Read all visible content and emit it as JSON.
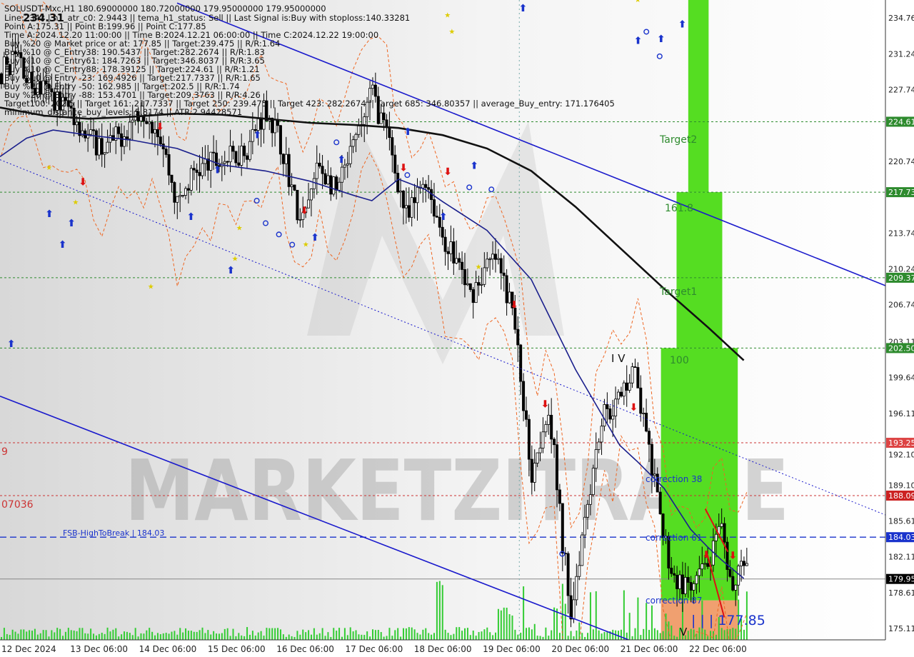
{
  "header": {
    "symbol_line": "SOLUSDT-Mxc,H1  180.69000000 180.72000000 179.95000000 179.95000000",
    "price_tag": "234.31",
    "lines": [
      "Line:2342 | h1_atr_c0: 2.9443 || tema_h1_status: Sell || Last Signal is:Buy with stoploss:140.33281",
      "Point A:175.31 || Point B:199.96 || Point C:177.85",
      "Time A:2024.12.20 11:00:00 || Time B:2024.12.21 06:00:00 || Time C:2024.12.22 19:00:00",
      "Buy %20 @ Market price or at: 177.85 || Target:239.475 || R/R:1.64",
      "Buy %10 @ C_Entry38: 190.5437 || Target:282.2674 || R/R:1.83",
      "Buy %10 @ C_Entry61: 184.7263 || Target:346.8037 || R/R:3.65",
      "Buy %10 @ C_Entry88: 178.39125 || Target:224.61 || R/R:1.21",
      "Buy %10 @ Entry -23: 169.4926 || Target:217.7337 || R/R:1.65",
      "Buy %20 @ Entry -50: 162.985 || Target:202.5 || R/R:1.74",
      "Buy %20 @ Entry -88: 153.4701 || Target:209.3763 || R/R:4.26",
      "Target100: 202.5 || Target 161: 217.7337 || Target 250: 239.475 || Target 423: 282.2674 || Target 685: 346.80357 || average_Buy_entry: 171.176405",
      "minimum_distance_buy_levels: 5.8174 || ATR:2.94428571"
    ]
  },
  "levels": {
    "target2": "Target2",
    "l1618": "161.8",
    "target1": "Target1",
    "l100": "100",
    "corr38": "correction 38",
    "corr61": "correction 61",
    "corr87": "correction 87",
    "fsb": "FSB-HighToBreak | 184.03",
    "pointc": "| | | 177.85",
    "left_9": "9",
    "left_07036": "07036",
    "label_iv": "I V",
    "label_v": "V"
  },
  "watermark": "MARKETZITRADE",
  "colors": {
    "bull": "#000000",
    "bear": "#000000",
    "green_zone": "#55dd22",
    "orange_zone": "#f0a070",
    "ma_blue": "#1a1f8c",
    "ma_black": "#111111",
    "channel": "#1a1acc",
    "buy_arrow": "#1a33cc",
    "sell_arrow": "#dd1111"
  },
  "chart_data": {
    "type": "candlestick",
    "y_ticks": [
      "234.76",
      "231.24",
      "227.74",
      "224.61",
      "220.74",
      "217.73",
      "213.74",
      "210.24",
      "209.37",
      "206.74",
      "203.11",
      "202.50",
      "199.64",
      "196.11",
      "193.25",
      "192.10",
      "189.10",
      "188.09",
      "185.61",
      "184.03",
      "182.11",
      "179.95",
      "178.61",
      "175.11"
    ],
    "y_axis_labels": [
      {
        "value": 234.76,
        "text": "234.76"
      },
      {
        "value": 231.24,
        "text": "231.24"
      },
      {
        "value": 227.74,
        "text": "227.74"
      },
      {
        "value": 224.61,
        "text": "224.61",
        "box": "#2e8b2e"
      },
      {
        "value": 220.74,
        "text": "220.74"
      },
      {
        "value": 217.73,
        "text": "217.73",
        "box": "#2e8b2e"
      },
      {
        "value": 213.74,
        "text": "213.74"
      },
      {
        "value": 210.24,
        "text": "210.24"
      },
      {
        "value": 209.37,
        "text": "209.37",
        "box": "#2e8b2e"
      },
      {
        "value": 206.74,
        "text": "206.74"
      },
      {
        "value": 203.11,
        "text": "203.11"
      },
      {
        "value": 202.5,
        "text": "202.50",
        "box": "#2e8b2e"
      },
      {
        "value": 199.64,
        "text": "199.64"
      },
      {
        "value": 196.11,
        "text": "196.11"
      },
      {
        "value": 193.25,
        "text": "193.25",
        "box": "#dd4444"
      },
      {
        "value": 192.1,
        "text": "192.10"
      },
      {
        "value": 189.1,
        "text": "189.10"
      },
      {
        "value": 188.09,
        "text": "188.09",
        "box": "#cc2222"
      },
      {
        "value": 185.61,
        "text": "185.61"
      },
      {
        "value": 184.03,
        "text": "184.03",
        "box": "#1a33cc"
      },
      {
        "value": 182.11,
        "text": "182.11"
      },
      {
        "value": 179.95,
        "text": "179.95",
        "box": "#000000"
      },
      {
        "value": 178.61,
        "text": "178.61"
      },
      {
        "value": 175.11,
        "text": "175.11"
      }
    ],
    "x_ticks": [
      "12 Dec 2024",
      "13 Dec 06:00",
      "14 Dec 06:00",
      "15 Dec 06:00",
      "16 Dec 06:00",
      "17 Dec 06:00",
      "18 Dec 06:00",
      "19 Dec 06:00",
      "20 Dec 06:00",
      "21 Dec 06:00",
      "22 Dec 06:00"
    ],
    "ylim": [
      174.0,
      236.5
    ],
    "horizontal_levels": [
      {
        "value": 224.61,
        "style": "dotted",
        "color": "#2e8b2e"
      },
      {
        "value": 217.73,
        "style": "dotted",
        "color": "#2e8b2e"
      },
      {
        "value": 209.37,
        "style": "dotted",
        "color": "#2e8b2e"
      },
      {
        "value": 202.5,
        "style": "dotted",
        "color": "#2e8b2e"
      },
      {
        "value": 193.25,
        "style": "dotted",
        "color": "#cc3333"
      },
      {
        "value": 188.09,
        "style": "dotted",
        "color": "#cc3333"
      },
      {
        "value": 184.03,
        "style": "dashed",
        "color": "#1a33cc"
      },
      {
        "value": 179.95,
        "style": "solid",
        "color": "#888888"
      }
    ],
    "zones": [
      {
        "name": "target2-zone",
        "x0": 0.7773,
        "x1": 0.8003,
        "y0": 236.5,
        "y1": 217.73,
        "color": "#55dd22"
      },
      {
        "name": "161-zone",
        "x0": 0.7641,
        "x1": 0.8157,
        "y0": 217.73,
        "y1": 202.5,
        "color": "#55dd22"
      },
      {
        "name": "100-zone",
        "x0": 0.7465,
        "x1": 0.8332,
        "y0": 202.5,
        "y1": 177.85,
        "color": "#55dd22"
      },
      {
        "name": "corr87-zone",
        "x0": 0.7465,
        "x1": 0.8332,
        "y0": 177.85,
        "y1": 174.0,
        "color": "#f0a070"
      }
    ],
    "channel_lines": [
      {
        "name": "upper-channel",
        "t0": 0.2,
        "v0": 236.2,
        "t1": 1.0,
        "v1": 208.6,
        "style": "solid",
        "width": 1.6
      },
      {
        "name": "lower-channel",
        "t0": 0.0,
        "v0": 197.8,
        "t1": 0.71,
        "v1": 174.0,
        "style": "solid",
        "width": 1.6
      },
      {
        "name": "mid-channel",
        "t0": 0.0,
        "v0": 220.9,
        "t1": 1.0,
        "v1": 186.2,
        "style": "dotted",
        "width": 1.0
      }
    ],
    "ma_black": [
      [
        0.0,
        226.0
      ],
      [
        0.05,
        225.2
      ],
      [
        0.1,
        224.9
      ],
      [
        0.15,
        225.1
      ],
      [
        0.2,
        225.4
      ],
      [
        0.25,
        225.3
      ],
      [
        0.3,
        224.9
      ],
      [
        0.35,
        224.5
      ],
      [
        0.4,
        224.3
      ],
      [
        0.45,
        224.0
      ],
      [
        0.5,
        223.3
      ],
      [
        0.55,
        222.0
      ],
      [
        0.6,
        219.8
      ],
      [
        0.65,
        216.3
      ],
      [
        0.7,
        212.3
      ],
      [
        0.75,
        208.3
      ],
      [
        0.8,
        204.5
      ],
      [
        0.84,
        201.3
      ]
    ],
    "ma_blue": [
      [
        0.0,
        221.2
      ],
      [
        0.03,
        223.0
      ],
      [
        0.06,
        223.8
      ],
      [
        0.1,
        223.3
      ],
      [
        0.15,
        222.8
      ],
      [
        0.2,
        222.0
      ],
      [
        0.25,
        220.4
      ],
      [
        0.3,
        219.8
      ],
      [
        0.35,
        218.8
      ],
      [
        0.4,
        217.4
      ],
      [
        0.42,
        216.9
      ],
      [
        0.45,
        219.0
      ],
      [
        0.48,
        218.0
      ],
      [
        0.5,
        216.8
      ],
      [
        0.55,
        214.0
      ],
      [
        0.6,
        209.2
      ],
      [
        0.65,
        200.4
      ],
      [
        0.7,
        193.0
      ],
      [
        0.72,
        191.4
      ],
      [
        0.75,
        188.8
      ],
      [
        0.78,
        184.8
      ],
      [
        0.8,
        183.0
      ],
      [
        0.815,
        181.8
      ],
      [
        0.84,
        180.0
      ]
    ],
    "ohlc_path": [
      [
        0.0,
        229.3
      ],
      [
        0.02,
        231.2
      ],
      [
        0.035,
        228.2
      ],
      [
        0.05,
        227.6
      ],
      [
        0.06,
        227.0
      ],
      [
        0.08,
        225.8
      ],
      [
        0.1,
        223.0
      ],
      [
        0.12,
        222.0
      ],
      [
        0.14,
        223.6
      ],
      [
        0.16,
        226.2
      ],
      [
        0.18,
        223.8
      ],
      [
        0.2,
        216.4
      ],
      [
        0.22,
        219.8
      ],
      [
        0.24,
        220.6
      ],
      [
        0.26,
        221.0
      ],
      [
        0.28,
        222.2
      ],
      [
        0.3,
        226.2
      ],
      [
        0.32,
        221.8
      ],
      [
        0.34,
        214.2
      ],
      [
        0.36,
        220.4
      ],
      [
        0.38,
        217.6
      ],
      [
        0.4,
        222.2
      ],
      [
        0.42,
        227.6
      ],
      [
        0.44,
        222.4
      ],
      [
        0.46,
        214.8
      ],
      [
        0.48,
        219.4
      ],
      [
        0.5,
        213.4
      ],
      [
        0.52,
        210.4
      ],
      [
        0.53,
        207.6
      ],
      [
        0.55,
        210.4
      ],
      [
        0.56,
        211.2
      ],
      [
        0.58,
        205.8
      ],
      [
        0.6,
        190.4
      ],
      [
        0.62,
        197.1
      ],
      [
        0.635,
        183.8
      ],
      [
        0.645,
        176.7
      ],
      [
        0.66,
        186.0
      ],
      [
        0.68,
        195.9
      ],
      [
        0.7,
        197.4
      ],
      [
        0.715,
        200.9
      ],
      [
        0.73,
        193.8
      ],
      [
        0.745,
        186.0
      ],
      [
        0.76,
        180.2
      ],
      [
        0.78,
        178.5
      ],
      [
        0.8,
        181.6
      ],
      [
        0.815,
        184.4
      ],
      [
        0.825,
        178.8
      ],
      [
        0.835,
        181.5
      ],
      [
        0.845,
        179.95
      ]
    ],
    "volume_seed": 7
  }
}
